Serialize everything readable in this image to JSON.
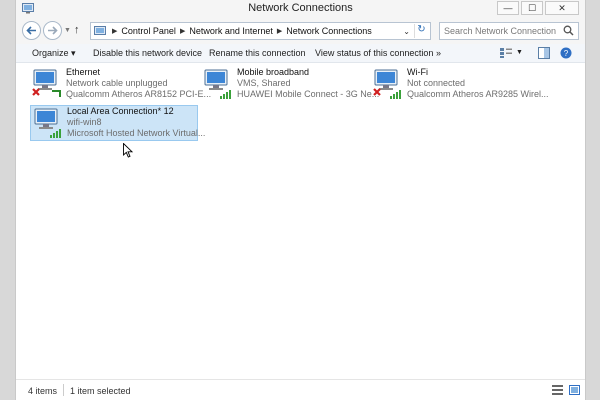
{
  "window": {
    "title": "Network Connections"
  },
  "titlebar_buttons": {
    "minimize": "—",
    "maximize": "☐",
    "close": "✕"
  },
  "nav": {
    "back": "back-arrow-icon",
    "forward": "forward-arrow-icon"
  },
  "address": {
    "breadcrumbs": [
      "Control Panel",
      "Network and Internet",
      "Network Connections"
    ]
  },
  "search": {
    "placeholder": "Search Network Connections"
  },
  "toolbar": {
    "organize": "Organize ▾",
    "disable": "Disable this network device",
    "rename": "Rename this connection",
    "view_status": "View status of this connection",
    "more": "»"
  },
  "connections": [
    {
      "name": "Ethernet",
      "status": "Network cable unplugged",
      "device": "Qualcomm Atheros AR8152 PCI-E...",
      "icon": "ethernet-disconnected-icon"
    },
    {
      "name": "Mobile broadband",
      "status": "VMS, Shared",
      "device": "HUAWEI Mobile Connect - 3G Ne...",
      "icon": "mobile-broadband-icon"
    },
    {
      "name": "Wi-Fi",
      "status": "Not connected",
      "device": "Qualcomm Atheros AR9285 Wirel...",
      "icon": "wifi-disconnected-icon"
    },
    {
      "name": "Local Area Connection* 12",
      "status": "wifi-win8",
      "device": "Microsoft Hosted Network Virtual...",
      "icon": "hosted-network-icon"
    }
  ],
  "statusbar": {
    "item_count": "4 items",
    "selection": "1 item selected"
  },
  "colors": {
    "selection_bg": "#cce4f7",
    "selection_border": "#99c9ef",
    "signal_green": "#3aa13a",
    "error_red": "#d02020"
  }
}
